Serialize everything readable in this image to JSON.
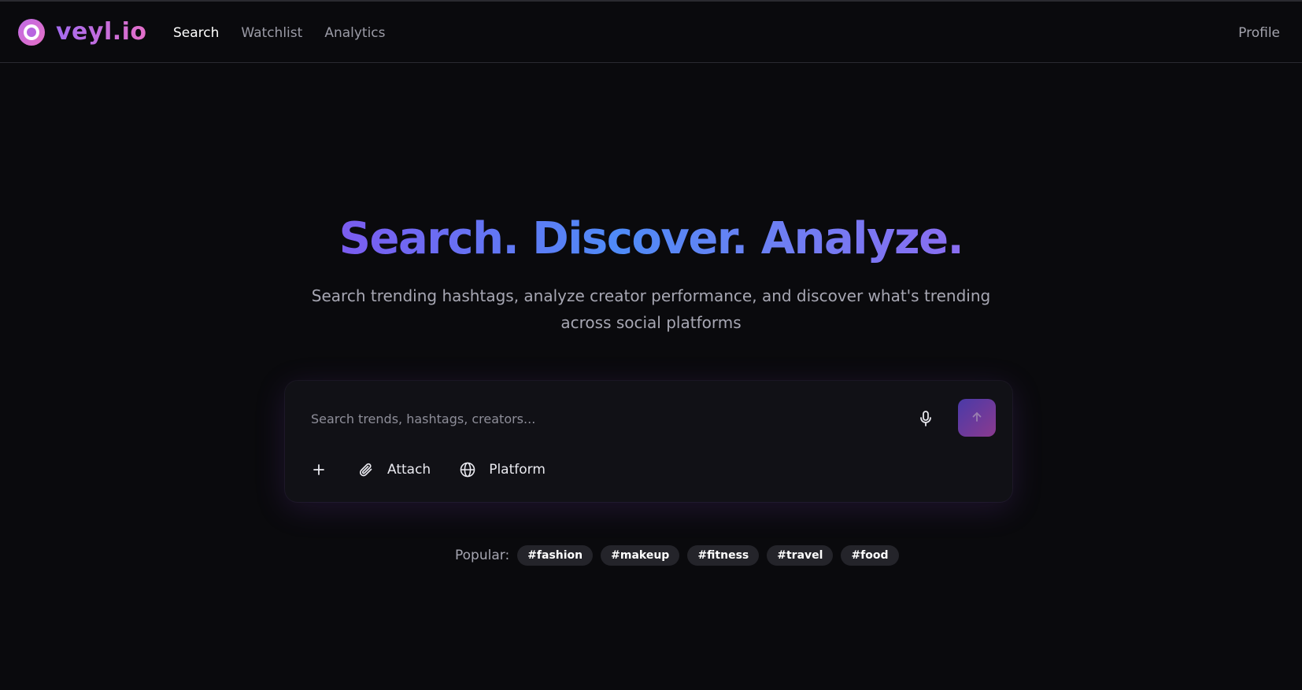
{
  "brand": {
    "name": "veyl.io",
    "logo_icon": "eye-logo-icon"
  },
  "nav": {
    "items": [
      {
        "label": "Search",
        "active": true
      },
      {
        "label": "Watchlist",
        "active": false
      },
      {
        "label": "Analytics",
        "active": false
      }
    ],
    "profile_label": "Profile"
  },
  "hero": {
    "title": "Search. Discover. Analyze.",
    "subtitle": "Search trending hashtags, analyze creator performance, and discover what's trending across social platforms"
  },
  "search": {
    "placeholder": "Search trends, hashtags, creators...",
    "mic_icon": "microphone-icon",
    "send_icon": "arrow-up-icon",
    "tools": [
      {
        "icon": "plus-icon",
        "label": ""
      },
      {
        "icon": "paperclip-icon",
        "label": "Attach"
      },
      {
        "icon": "globe-icon",
        "label": "Platform"
      }
    ]
  },
  "popular": {
    "label": "Popular:",
    "tags": [
      "#fashion",
      "#makeup",
      "#fitness",
      "#travel",
      "#food"
    ]
  },
  "colors": {
    "background": "#0a0a0d",
    "brand_gradient_start": "#a46bf0",
    "brand_gradient_end": "#e46fc9",
    "title_gradient_mid": "#4f8bf7",
    "send_gradient_start": "#4a3aa8",
    "send_gradient_end": "#8b3a8f"
  }
}
